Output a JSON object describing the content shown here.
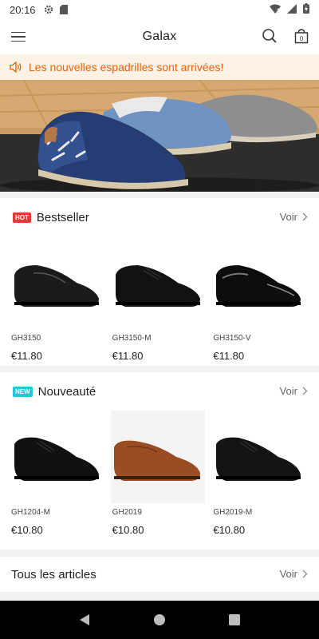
{
  "status_bar": {
    "time": "20:16"
  },
  "app_bar": {
    "title": "Galax",
    "cart_count": "0"
  },
  "notice": {
    "text": "Les nouvelles espadrilles sont arrivées!"
  },
  "bestseller": {
    "badge": "HOT",
    "title": "Bestseller",
    "more": "Voir",
    "products": [
      {
        "code": "GH3150",
        "price": "€11.80"
      },
      {
        "code": "GH3150-M",
        "price": "€11.80"
      },
      {
        "code": "GH3150-V",
        "price": "€11.80"
      }
    ]
  },
  "nouveaute": {
    "badge": "NEW",
    "title": "Nouveauté",
    "more": "Voir",
    "products": [
      {
        "code": "GH1204-M",
        "price": "€10.80"
      },
      {
        "code": "GH2019",
        "price": "€10.80"
      },
      {
        "code": "GH2019-M",
        "price": "€10.80"
      }
    ]
  },
  "all_articles": {
    "label": "Tous les articles",
    "more": "Voir"
  },
  "colors": {
    "accent": "#e8620a",
    "hot": "#e53935",
    "new": "#26c6da"
  }
}
